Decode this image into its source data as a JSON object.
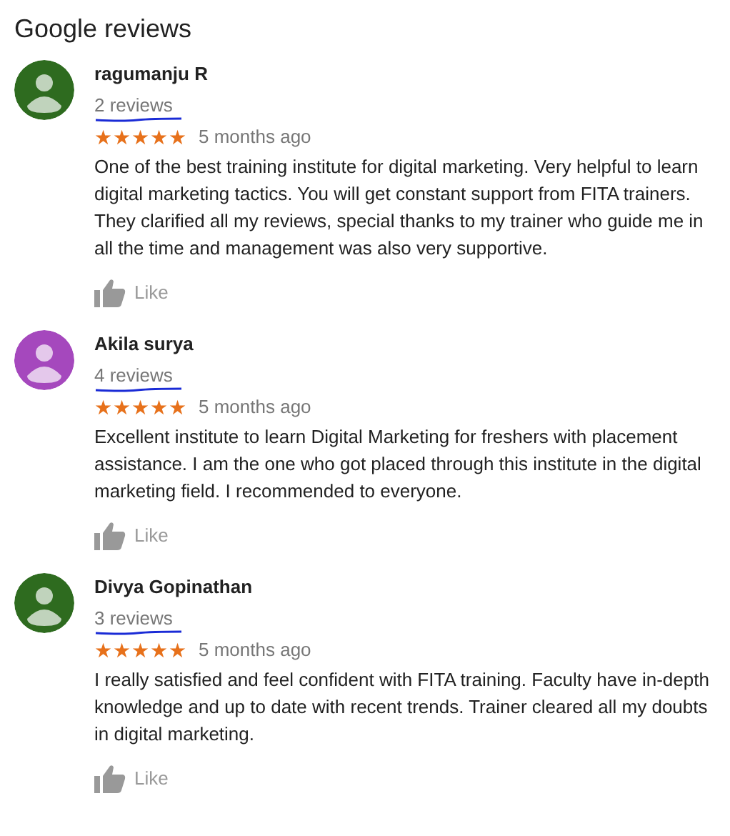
{
  "title": "Google reviews",
  "reviews": [
    {
      "name": "ragumanju R",
      "count": "2 reviews",
      "marked": true,
      "color": "#2e6b1f",
      "stars": 5,
      "time": "5 months ago",
      "text": "One of the best training institute for digital marketing. Very helpful to learn digital marketing tactics. You will get constant support from FITA trainers. They clarified all my reviews, special thanks to my trainer who guide me in all the time and management was also very supportive.",
      "like": "Like"
    },
    {
      "name": "Akila surya",
      "count": "4 reviews",
      "marked": true,
      "color": "#a548bd",
      "stars": 5,
      "time": "5 months ago",
      "text": "Excellent institute to learn Digital Marketing for freshers with placement assistance. I am the one who got placed through this institute in the digital marketing field. I recommended to everyone.",
      "like": "Like"
    },
    {
      "name": "Divya Gopinathan",
      "count": "3 reviews",
      "marked": true,
      "color": "#2e6b1f",
      "stars": 5,
      "time": "5 months ago",
      "text": "I really satisfied and feel confident with FITA training. Faculty have in-depth knowledge and up to date with recent trends. Trainer cleared all my doubts in digital marketing.",
      "like": "Like"
    }
  ]
}
